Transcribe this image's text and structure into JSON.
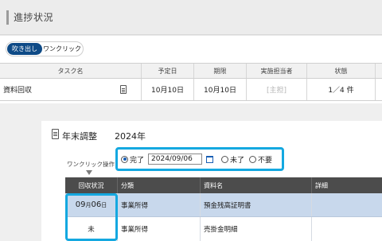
{
  "header": {
    "title": "進捗状況"
  },
  "view_toggle": {
    "balloon_label": "吹き出し",
    "oneclick_label": "ワンクリック"
  },
  "task_table": {
    "columns": [
      "タスク名",
      "予定日",
      "期限",
      "実施担当者",
      "状態"
    ],
    "row": {
      "task_name": "資料回収",
      "icon": "document-icon",
      "planned_date": "10月10日",
      "deadline": "10月10日",
      "assignee": "[主担]",
      "status": "1／4 件"
    }
  },
  "panel": {
    "title": "年末調整",
    "year": "2024年",
    "oneclick": {
      "label": "ワンクリック操作：",
      "option_done": "完了",
      "date_value": "2024/09/06",
      "option_not_done": "未了",
      "option_unneeded": "不要",
      "selected": "完了"
    },
    "sub_table": {
      "columns": [
        "回収状況",
        "分類",
        "資料名",
        "詳細"
      ],
      "rows": [
        {
          "status_month": "09",
          "status_month_unit": "月",
          "status_day": "06",
          "status_day_unit": "日",
          "category": "事業所得",
          "document": "預金残高証明書",
          "detail": ""
        },
        {
          "status": "未",
          "category": "事業所得",
          "document": "売掛金明細",
          "detail": ""
        }
      ]
    }
  },
  "colors": {
    "accent_blue": "#0e4a86",
    "highlight": "#14a8e0",
    "selected_row": "#c8d8ec",
    "table_header_dark": "#4c4c4c"
  }
}
